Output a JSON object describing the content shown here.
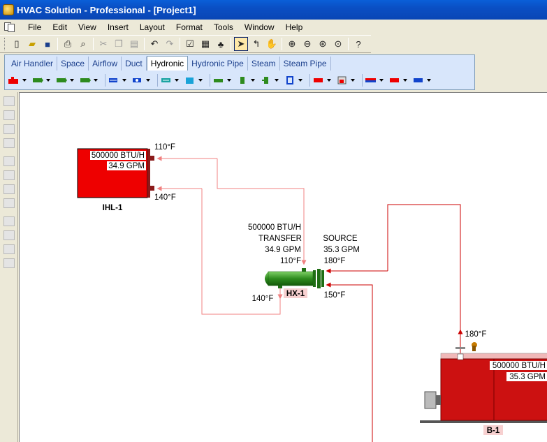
{
  "window": {
    "title": "HVAC Solution - Professional - [Project1]"
  },
  "menu": {
    "items": [
      "File",
      "Edit",
      "View",
      "Insert",
      "Layout",
      "Format",
      "Tools",
      "Window",
      "Help"
    ]
  },
  "tabs": {
    "items": [
      "Air Handler",
      "Space",
      "Airflow",
      "Duct",
      "Hydronic",
      "Hydronic Pipe",
      "Steam",
      "Steam Pipe"
    ],
    "selected": "Hydronic"
  },
  "colors": {
    "pipe": "#f08080",
    "pipe_supply": "#cc0000",
    "equipment_red": "#ee0000",
    "boiler_red": "#cc1111",
    "hx_green": "#2e8b1e"
  },
  "diagram": {
    "ihl": {
      "name": "IHL-1",
      "capacity": "500000 BTU/H",
      "flow": "34.9 GPM",
      "supply_temp": "110°F",
      "return_temp": "140°F"
    },
    "hx": {
      "name": "HX-1",
      "transfer_capacity": "500000 BTU/H",
      "transfer_label": "TRANSFER",
      "transfer_flow": "34.9 GPM",
      "transfer_temp_in": "110°F",
      "transfer_temp_out": "140°F",
      "source_label": "SOURCE",
      "source_flow": "35.3 GPM",
      "source_temp_in": "180°F",
      "source_temp_out": "150°F"
    },
    "boiler": {
      "name": "B-1",
      "capacity": "500000 BTU/H",
      "flow": "35.3 GPM",
      "outlet_temp": "180°F"
    }
  }
}
